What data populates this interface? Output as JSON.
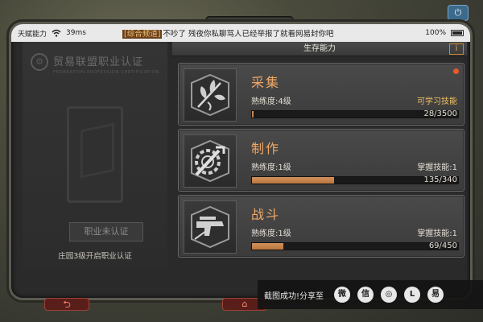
{
  "status_bar": {
    "left_label": "天赋能力",
    "ping": "39ms",
    "message_tag": "[综合频道]",
    "message_text": "不吵了 残夜你私聊骂人已经举报了就看网易封你吧",
    "battery": "100%"
  },
  "left_panel": {
    "title": "贸易联盟职业认证",
    "subtitle": "FEDERATION PROFESSION CERTIFICATION",
    "uncertified_label": "职业未认证",
    "hint": "庄园3级开启职业认证"
  },
  "right_panel": {
    "header": "生存能力",
    "info_button": "i",
    "skills": [
      {
        "name": "采集",
        "level": "熟练度:4级",
        "right_text": "可学习技能",
        "progress_text": "28/3500",
        "progress_fraction": 0.008,
        "has_new": true,
        "icon": "leaf-icon"
      },
      {
        "name": "制作",
        "level": "熟练度:1级",
        "right_text": "掌握技能:1",
        "progress_text": "135/340",
        "progress_fraction": 0.397,
        "has_new": false,
        "icon": "wrench-gear-icon"
      },
      {
        "name": "战斗",
        "level": "熟练度:1级",
        "right_text": "掌握技能:1",
        "progress_text": "69/450",
        "progress_fraction": 0.153,
        "has_new": false,
        "icon": "gun-icon"
      }
    ]
  },
  "share_bar": {
    "label": "截图成功!分享至",
    "targets": [
      "weibo-icon",
      "wechat-icon",
      "moments-icon",
      "lofter-icon",
      "yixin-icon"
    ]
  },
  "nav": {
    "back_glyph": "⮌",
    "home_glyph": "⌂"
  },
  "colors": {
    "accent_orange": "#f0a866",
    "progress_fill": "#c9834a",
    "learnable_yellow": "#f0c060",
    "new_dot": "#e65a2a"
  }
}
